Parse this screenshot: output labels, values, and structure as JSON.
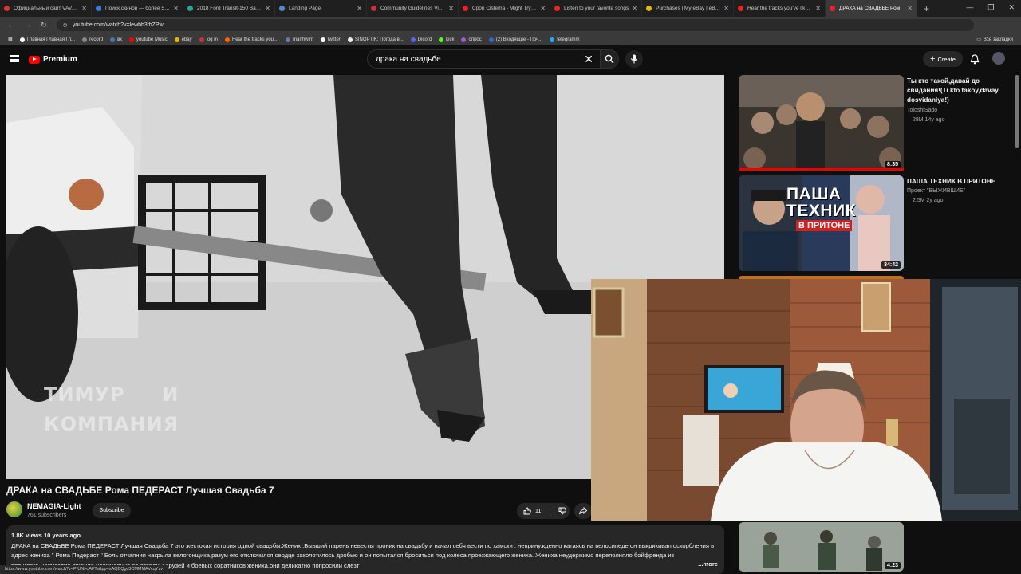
{
  "browser": {
    "tabs": [
      {
        "label": "Официальный сайт VAVADA",
        "color": "#d33"
      },
      {
        "label": "Поиск скинов — более 5000",
        "color": "#3a7bd5"
      },
      {
        "label": "2018 Ford Transit-150 Base w",
        "color": "#2a9"
      },
      {
        "label": "Landing Page",
        "color": "#58c"
      },
      {
        "label": "Community Guidelines Violati",
        "color": "#c33"
      },
      {
        "label": "Cpon Cistema - Might Try - Y",
        "color": "#e22"
      },
      {
        "label": "Listen to your favorite songs",
        "color": "#e22"
      },
      {
        "label": "Purchases | My eBay | eBay",
        "color": "#e6b800"
      },
      {
        "label": "Hear the tracks you've liked:",
        "color": "#e22"
      },
      {
        "label": "ДРАКА на СВАДЬБЕ Ром",
        "color": "#e22"
      }
    ],
    "url": "youtube.com/watch?v=lewbh3fhZPw",
    "bookmarks": [
      "Главная Главная Гл...",
      "record",
      "вк",
      "youtube Music",
      "ebay",
      "log in",
      "Hear the tracks you'...",
      "manhwim",
      "twitter",
      "SINOPTIK: Погода в...",
      "Dicord",
      "kick",
      "опрос",
      "(2) Входящие - Поч...",
      "telegramm"
    ],
    "bookmarks_end": "Все закладки",
    "status_url": "https://www.youtube.com/watch?v=PfUNf-cAFTs&pp=sAQBQgc3CMMMAVcqYzv"
  },
  "header": {
    "logo": "Premium",
    "search_value": "драка на свадьбе",
    "create_label": "Create"
  },
  "player": {
    "watermark_line1": "ТИМУР     И",
    "watermark_line2": "КОМПАНИЯ"
  },
  "video": {
    "title": "ДРАКА на СВАДЬБЕ Рома ПЕДЕРАСТ Лучшая Свадьба 7",
    "channel": "NEMAGIA-Light",
    "subscribers": "761 subscribers",
    "subscribe_label": "Subscribe",
    "likes": "11",
    "meta": "1.8K views  10 years ago",
    "description": "ДРАКА на СВАДЬБЕ Рома ПЕДЕРАСТ Лучшая Свадьба 7 это жестокая история одной свадьбы.Жених .Бывший парень невесты проник на свадьбу и начал себя вести по хамски , непринужденно катаясь на велосипеде он выкрикивал оскорбления в адрес жениха \" Рома Педераст \" Боль отчаяния накрыла велогонщика,разум его отключился,сердце заколотилось дробью и он попытался броситься под колеса проезжающего жениха. Жениха неудержимо переполняло бойфренда из прошлого.Возмездие пришло неожиданно со стороны друзей и боевых соратников жениха,они деликатно попросили слезт",
    "more_label": "...more"
  },
  "recommendations": [
    {
      "title": "Ты кто такой,давай до свидания!(Ti kto takoy,davay dosvidaniya!)",
      "channel": "ToloshiSado",
      "views": "28M  14y ago",
      "duration": "8:35"
    },
    {
      "title": "ПАША ТЕХНИК В ПРИТОНЕ",
      "channel": "Проект \"ВЫЖИВШИЕ\"",
      "views": "2.5M  2y ago",
      "duration": "34:42",
      "overlay1": "ПАША",
      "overlay2": "ТЕХНИК",
      "overlay3": "В ПРИТОНЕ"
    },
    {
      "title": "",
      "channel": "",
      "views": "",
      "duration": ""
    },
    {
      "title": "",
      "channel": "",
      "views": "",
      "duration": "4:23"
    }
  ]
}
